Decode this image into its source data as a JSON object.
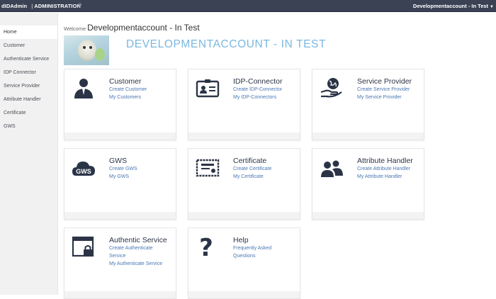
{
  "topbar": {
    "brand": "dIDAdmin",
    "section": "ADMINISTRATION",
    "account": "Developmentaccount - In Test",
    "pin_icon": "pin-icon",
    "caret_icon": "caret-down-icon"
  },
  "sidebar": {
    "items": [
      {
        "label": "Home",
        "active": true
      },
      {
        "label": "Customer"
      },
      {
        "label": "Authenticate Service"
      },
      {
        "label": "IDP Connector"
      },
      {
        "label": "Service Provider"
      },
      {
        "label": "Attribute Handler"
      },
      {
        "label": "Certificate"
      },
      {
        "label": "GWS"
      }
    ]
  },
  "main": {
    "welcome_lead": "Welcome",
    "welcome_name": "Developmentaccount - In Test",
    "account_title": "DEVELOPMENTACCOUNT - IN TEST",
    "cards": [
      {
        "title": "Customer",
        "icon": "user-icon",
        "links": [
          "Create Customer",
          "My Customers"
        ]
      },
      {
        "title": "IDP-Connector",
        "icon": "id-card-icon",
        "links": [
          "Create IDP-Connector",
          "My IDP-Connectors"
        ]
      },
      {
        "title": "Service Provider",
        "icon": "globe-hand-icon",
        "links": [
          "Create Service Provider",
          "My Service Provider"
        ]
      },
      {
        "title": "GWS",
        "icon": "cloud-icon",
        "icon_text": "GWS",
        "links": [
          "Create GWS",
          "My GWS"
        ]
      },
      {
        "title": "Certificate",
        "icon": "certificate-icon",
        "links": [
          "Create Certificate",
          "My Certificate"
        ]
      },
      {
        "title": "Attribute Handler",
        "icon": "users-icon",
        "links": [
          "Create Attribute Handler",
          "My Attribute Handler"
        ]
      },
      {
        "title": "Authentic Service",
        "icon": "window-lock-icon",
        "links": [
          "Create Authenticate",
          "Service",
          "My Authenticate Service"
        ]
      },
      {
        "title": "Help",
        "icon": "question-icon",
        "icon_text": "?",
        "links": [
          "Frequently Asked",
          "Questions"
        ]
      }
    ]
  },
  "colors": {
    "topbar": "#3a4254",
    "link": "#4a77b4",
    "accent_title": "#7ab8de",
    "icon": "#2b3447"
  }
}
